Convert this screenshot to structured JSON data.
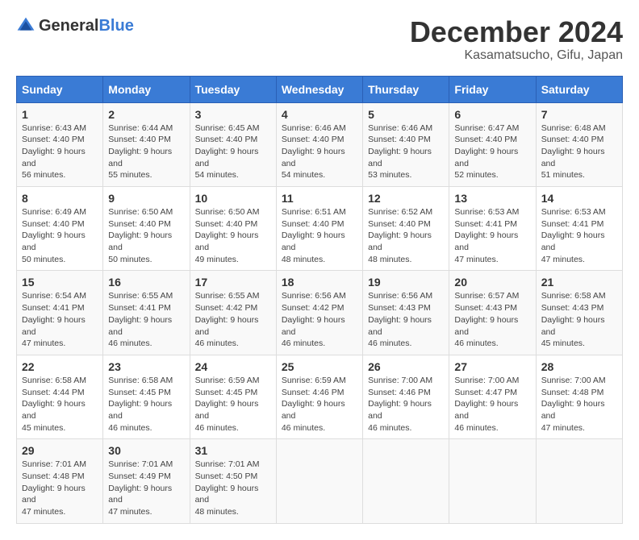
{
  "header": {
    "logo_general": "General",
    "logo_blue": "Blue",
    "month_title": "December 2024",
    "location": "Kasamatsucho, Gifu, Japan"
  },
  "days_of_week": [
    "Sunday",
    "Monday",
    "Tuesday",
    "Wednesday",
    "Thursday",
    "Friday",
    "Saturday"
  ],
  "weeks": [
    [
      {
        "day": "1",
        "sunrise": "6:43 AM",
        "sunset": "4:40 PM",
        "daylight": "9 hours and 56 minutes."
      },
      {
        "day": "2",
        "sunrise": "6:44 AM",
        "sunset": "4:40 PM",
        "daylight": "9 hours and 55 minutes."
      },
      {
        "day": "3",
        "sunrise": "6:45 AM",
        "sunset": "4:40 PM",
        "daylight": "9 hours and 54 minutes."
      },
      {
        "day": "4",
        "sunrise": "6:46 AM",
        "sunset": "4:40 PM",
        "daylight": "9 hours and 54 minutes."
      },
      {
        "day": "5",
        "sunrise": "6:46 AM",
        "sunset": "4:40 PM",
        "daylight": "9 hours and 53 minutes."
      },
      {
        "day": "6",
        "sunrise": "6:47 AM",
        "sunset": "4:40 PM",
        "daylight": "9 hours and 52 minutes."
      },
      {
        "day": "7",
        "sunrise": "6:48 AM",
        "sunset": "4:40 PM",
        "daylight": "9 hours and 51 minutes."
      }
    ],
    [
      {
        "day": "8",
        "sunrise": "6:49 AM",
        "sunset": "4:40 PM",
        "daylight": "9 hours and 50 minutes."
      },
      {
        "day": "9",
        "sunrise": "6:50 AM",
        "sunset": "4:40 PM",
        "daylight": "9 hours and 50 minutes."
      },
      {
        "day": "10",
        "sunrise": "6:50 AM",
        "sunset": "4:40 PM",
        "daylight": "9 hours and 49 minutes."
      },
      {
        "day": "11",
        "sunrise": "6:51 AM",
        "sunset": "4:40 PM",
        "daylight": "9 hours and 48 minutes."
      },
      {
        "day": "12",
        "sunrise": "6:52 AM",
        "sunset": "4:40 PM",
        "daylight": "9 hours and 48 minutes."
      },
      {
        "day": "13",
        "sunrise": "6:53 AM",
        "sunset": "4:41 PM",
        "daylight": "9 hours and 47 minutes."
      },
      {
        "day": "14",
        "sunrise": "6:53 AM",
        "sunset": "4:41 PM",
        "daylight": "9 hours and 47 minutes."
      }
    ],
    [
      {
        "day": "15",
        "sunrise": "6:54 AM",
        "sunset": "4:41 PM",
        "daylight": "9 hours and 47 minutes."
      },
      {
        "day": "16",
        "sunrise": "6:55 AM",
        "sunset": "4:41 PM",
        "daylight": "9 hours and 46 minutes."
      },
      {
        "day": "17",
        "sunrise": "6:55 AM",
        "sunset": "4:42 PM",
        "daylight": "9 hours and 46 minutes."
      },
      {
        "day": "18",
        "sunrise": "6:56 AM",
        "sunset": "4:42 PM",
        "daylight": "9 hours and 46 minutes."
      },
      {
        "day": "19",
        "sunrise": "6:56 AM",
        "sunset": "4:43 PM",
        "daylight": "9 hours and 46 minutes."
      },
      {
        "day": "20",
        "sunrise": "6:57 AM",
        "sunset": "4:43 PM",
        "daylight": "9 hours and 46 minutes."
      },
      {
        "day": "21",
        "sunrise": "6:58 AM",
        "sunset": "4:43 PM",
        "daylight": "9 hours and 45 minutes."
      }
    ],
    [
      {
        "day": "22",
        "sunrise": "6:58 AM",
        "sunset": "4:44 PM",
        "daylight": "9 hours and 45 minutes."
      },
      {
        "day": "23",
        "sunrise": "6:58 AM",
        "sunset": "4:45 PM",
        "daylight": "9 hours and 46 minutes."
      },
      {
        "day": "24",
        "sunrise": "6:59 AM",
        "sunset": "4:45 PM",
        "daylight": "9 hours and 46 minutes."
      },
      {
        "day": "25",
        "sunrise": "6:59 AM",
        "sunset": "4:46 PM",
        "daylight": "9 hours and 46 minutes."
      },
      {
        "day": "26",
        "sunrise": "7:00 AM",
        "sunset": "4:46 PM",
        "daylight": "9 hours and 46 minutes."
      },
      {
        "day": "27",
        "sunrise": "7:00 AM",
        "sunset": "4:47 PM",
        "daylight": "9 hours and 46 minutes."
      },
      {
        "day": "28",
        "sunrise": "7:00 AM",
        "sunset": "4:48 PM",
        "daylight": "9 hours and 47 minutes."
      }
    ],
    [
      {
        "day": "29",
        "sunrise": "7:01 AM",
        "sunset": "4:48 PM",
        "daylight": "9 hours and 47 minutes."
      },
      {
        "day": "30",
        "sunrise": "7:01 AM",
        "sunset": "4:49 PM",
        "daylight": "9 hours and 47 minutes."
      },
      {
        "day": "31",
        "sunrise": "7:01 AM",
        "sunset": "4:50 PM",
        "daylight": "9 hours and 48 minutes."
      },
      null,
      null,
      null,
      null
    ]
  ]
}
